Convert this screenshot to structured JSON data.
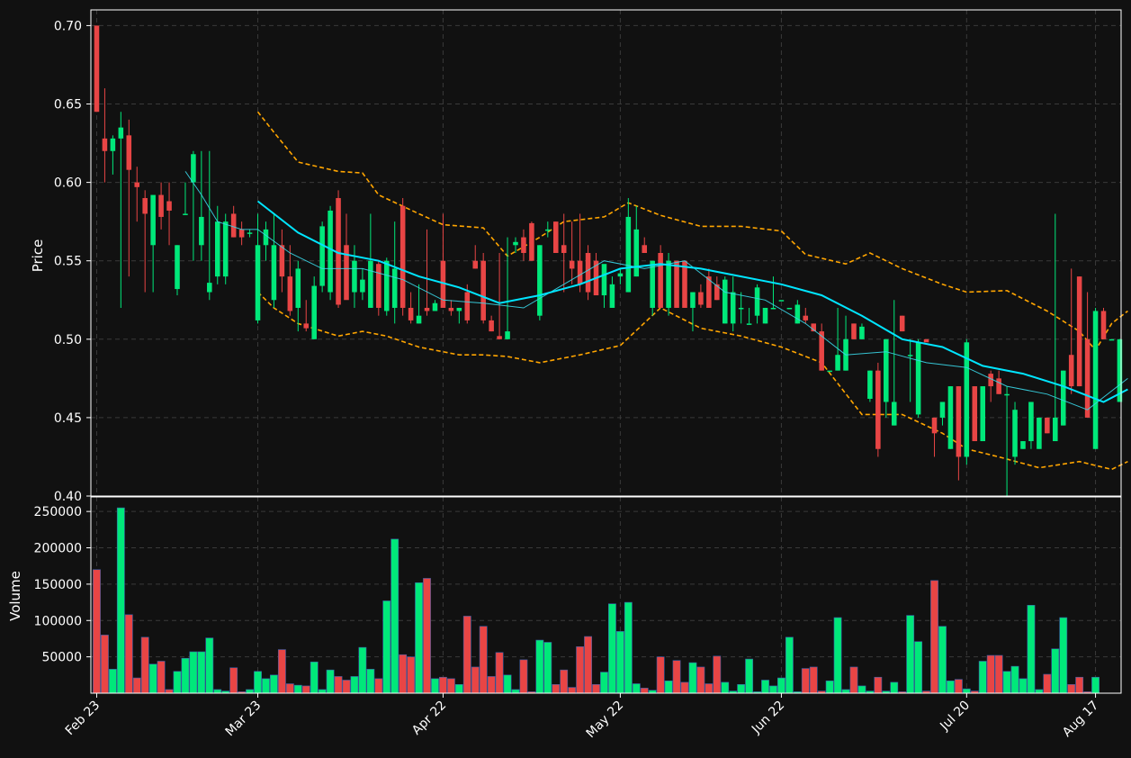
{
  "chart_data": [
    {
      "type": "candlestick",
      "ylabel": "Price",
      "ylim": [
        0.4,
        0.71
      ],
      "yticks": [
        "0.40",
        "0.45",
        "0.50",
        "0.55",
        "0.60",
        "0.65",
        "0.70"
      ],
      "x_tick_labels": [
        "Feb 23",
        "Mar 23",
        "Apr 22",
        "May 22",
        "Jun 22",
        "Jul 20",
        "Aug 17"
      ],
      "x_tick_bar_index": [
        0,
        20,
        43,
        65,
        85,
        108,
        124
      ],
      "grid": true,
      "colors": {
        "up": "#00e87a",
        "down": "#e84545",
        "ma_fast": "#3ad7e8",
        "ma_slow": "#00e5ff",
        "bands": "#ffa500",
        "background": "#111111",
        "grid": "#3a3a3a"
      },
      "series_candles": [
        [
          0.7,
          0.7,
          0.645,
          0.645
        ],
        [
          0.628,
          0.66,
          0.6,
          0.62
        ],
        [
          0.62,
          0.63,
          0.605,
          0.628
        ],
        [
          0.628,
          0.645,
          0.52,
          0.635
        ],
        [
          0.63,
          0.64,
          0.54,
          0.608
        ],
        [
          0.6,
          0.61,
          0.575,
          0.597
        ],
        [
          0.59,
          0.595,
          0.53,
          0.58
        ],
        [
          0.56,
          0.59,
          0.53,
          0.592
        ],
        [
          0.592,
          0.6,
          0.57,
          0.578
        ],
        [
          0.588,
          0.6,
          0.56,
          0.582
        ],
        [
          0.532,
          0.56,
          0.528,
          0.56
        ],
        [
          0.58,
          0.6,
          0.58,
          0.58
        ],
        [
          0.6,
          0.62,
          0.55,
          0.618
        ],
        [
          0.56,
          0.62,
          0.55,
          0.578
        ],
        [
          0.53,
          0.62,
          0.525,
          0.536
        ],
        [
          0.54,
          0.585,
          0.535,
          0.575
        ],
        [
          0.54,
          0.58,
          0.535,
          0.575
        ],
        [
          0.58,
          0.585,
          0.565,
          0.565
        ],
        [
          0.57,
          0.575,
          0.56,
          0.565
        ],
        [
          0.568,
          0.57,
          0.565,
          0.568
        ],
        [
          0.512,
          0.58,
          0.51,
          0.56
        ],
        [
          0.56,
          0.575,
          0.55,
          0.57
        ],
        [
          0.525,
          0.58,
          0.52,
          0.56
        ],
        [
          0.56,
          0.57,
          0.53,
          0.54
        ],
        [
          0.54,
          0.56,
          0.515,
          0.518
        ],
        [
          0.52,
          0.55,
          0.505,
          0.545
        ],
        [
          0.51,
          0.525,
          0.505,
          0.507
        ],
        [
          0.5,
          0.54,
          0.5,
          0.534
        ],
        [
          0.534,
          0.575,
          0.53,
          0.572
        ],
        [
          0.53,
          0.585,
          0.525,
          0.582
        ],
        [
          0.59,
          0.595,
          0.52,
          0.522
        ],
        [
          0.56,
          0.58,
          0.55,
          0.525
        ],
        [
          0.53,
          0.56,
          0.52,
          0.55
        ],
        [
          0.53,
          0.545,
          0.525,
          0.538
        ],
        [
          0.52,
          0.58,
          0.52,
          0.55
        ],
        [
          0.548,
          0.55,
          0.515,
          0.52
        ],
        [
          0.518,
          0.552,
          0.515,
          0.55
        ],
        [
          0.52,
          0.575,
          0.51,
          0.545
        ],
        [
          0.585,
          0.59,
          0.515,
          0.52
        ],
        [
          0.52,
          0.53,
          0.51,
          0.512
        ],
        [
          0.51,
          0.535,
          0.51,
          0.515
        ],
        [
          0.52,
          0.57,
          0.515,
          0.518
        ],
        [
          0.518,
          0.525,
          0.518,
          0.523
        ],
        [
          0.55,
          0.58,
          0.52,
          0.52
        ],
        [
          0.52,
          0.525,
          0.515,
          0.518
        ],
        [
          0.518,
          0.52,
          0.51,
          0.52
        ],
        [
          0.53,
          0.535,
          0.51,
          0.512
        ],
        [
          0.55,
          0.56,
          0.545,
          0.545
        ],
        [
          0.55,
          0.555,
          0.51,
          0.512
        ],
        [
          0.512,
          0.515,
          0.505,
          0.505
        ],
        [
          0.502,
          0.555,
          0.5,
          0.5
        ],
        [
          0.5,
          0.565,
          0.5,
          0.505
        ],
        [
          0.56,
          0.565,
          0.555,
          0.562
        ],
        [
          0.565,
          0.57,
          0.55,
          0.555
        ],
        [
          0.574,
          0.575,
          0.55,
          0.55
        ],
        [
          0.515,
          0.56,
          0.512,
          0.56
        ],
        [
          0.57,
          0.575,
          0.565,
          0.57
        ],
        [
          0.575,
          0.575,
          0.555,
          0.555
        ],
        [
          0.56,
          0.58,
          0.53,
          0.555
        ],
        [
          0.55,
          0.575,
          0.535,
          0.545
        ],
        [
          0.55,
          0.58,
          0.53,
          0.535
        ],
        [
          0.555,
          0.56,
          0.525,
          0.53
        ],
        [
          0.55,
          0.555,
          0.53,
          0.528
        ],
        [
          0.528,
          0.545,
          0.52,
          0.548
        ],
        [
          0.52,
          0.54,
          0.52,
          0.535
        ],
        [
          0.54,
          0.545,
          0.535,
          0.542
        ],
        [
          0.53,
          0.59,
          0.53,
          0.578
        ],
        [
          0.54,
          0.585,
          0.54,
          0.57
        ],
        [
          0.56,
          0.565,
          0.555,
          0.555
        ],
        [
          0.52,
          0.55,
          0.515,
          0.55
        ],
        [
          0.555,
          0.56,
          0.52,
          0.52
        ],
        [
          0.52,
          0.555,
          0.515,
          0.55
        ],
        [
          0.55,
          0.55,
          0.52,
          0.52
        ],
        [
          0.55,
          0.55,
          0.52,
          0.52
        ],
        [
          0.52,
          0.53,
          0.505,
          0.53
        ],
        [
          0.53,
          0.535,
          0.52,
          0.522
        ],
        [
          0.54,
          0.545,
          0.52,
          0.52
        ],
        [
          0.535,
          0.54,
          0.525,
          0.525
        ],
        [
          0.51,
          0.54,
          0.51,
          0.538
        ],
        [
          0.51,
          0.54,
          0.505,
          0.53
        ],
        [
          0.52,
          0.53,
          0.51,
          0.52
        ],
        [
          0.51,
          0.52,
          0.51,
          0.51
        ],
        [
          0.515,
          0.535,
          0.51,
          0.533
        ],
        [
          0.51,
          0.52,
          0.51,
          0.52
        ],
        [
          0.52,
          0.54,
          0.52,
          0.52
        ],
        [
          0.525,
          0.525,
          0.525,
          0.525
        ],
        [
          0.52,
          0.52,
          0.52,
          0.52
        ],
        [
          0.51,
          0.525,
          0.51,
          0.522
        ],
        [
          0.515,
          0.52,
          0.51,
          0.512
        ],
        [
          0.51,
          0.51,
          0.505,
          0.505
        ],
        [
          0.505,
          0.51,
          0.48,
          0.48
        ],
        [
          0.48,
          0.48,
          0.48,
          0.48
        ],
        [
          0.48,
          0.52,
          0.48,
          0.49
        ],
        [
          0.48,
          0.515,
          0.48,
          0.5
        ],
        [
          0.51,
          0.51,
          0.5,
          0.5
        ],
        [
          0.5,
          0.51,
          0.5,
          0.508
        ],
        [
          0.462,
          0.48,
          0.46,
          0.48
        ],
        [
          0.48,
          0.485,
          0.425,
          0.43
        ],
        [
          0.46,
          0.5,
          0.45,
          0.5
        ],
        [
          0.445,
          0.525,
          0.445,
          0.46
        ],
        [
          0.515,
          0.515,
          0.505,
          0.505
        ],
        [
          0.49,
          0.5,
          0.46,
          0.49
        ],
        [
          0.452,
          0.5,
          0.45,
          0.498
        ],
        [
          0.5,
          0.5,
          0.5,
          0.498
        ],
        [
          0.45,
          0.45,
          0.425,
          0.44
        ],
        [
          0.45,
          0.46,
          0.445,
          0.46
        ],
        [
          0.43,
          0.47,
          0.43,
          0.47
        ],
        [
          0.47,
          0.47,
          0.41,
          0.425
        ],
        [
          0.425,
          0.5,
          0.42,
          0.498
        ],
        [
          0.47,
          0.47,
          0.44,
          0.435
        ],
        [
          0.435,
          0.47,
          0.435,
          0.47
        ],
        [
          0.478,
          0.48,
          0.46,
          0.47
        ],
        [
          0.475,
          0.48,
          0.465,
          0.465
        ],
        [
          0.465,
          0.47,
          0.4,
          0.465
        ],
        [
          0.425,
          0.46,
          0.42,
          0.455
        ],
        [
          0.43,
          0.435,
          0.43,
          0.435
        ],
        [
          0.435,
          0.46,
          0.43,
          0.46
        ],
        [
          0.43,
          0.45,
          0.43,
          0.45
        ],
        [
          0.45,
          0.45,
          0.44,
          0.44
        ],
        [
          0.435,
          0.58,
          0.435,
          0.45
        ],
        [
          0.445,
          0.48,
          0.445,
          0.48
        ],
        [
          0.49,
          0.545,
          0.465,
          0.47
        ],
        [
          0.54,
          0.54,
          0.47,
          0.47
        ],
        [
          0.5,
          0.53,
          0.45,
          0.45
        ],
        [
          0.43,
          0.52,
          0.43,
          0.518
        ],
        [
          0.518,
          0.52,
          0.5,
          0.5
        ],
        [
          0.5,
          0.5,
          0.5,
          0.5
        ],
        [
          0.46,
          0.5,
          0.46,
          0.5
        ]
      ],
      "ma_fast": [
        [
          11,
          0.607
        ],
        [
          13,
          0.592
        ],
        [
          15,
          0.575
        ],
        [
          18,
          0.57
        ],
        [
          20,
          0.57
        ],
        [
          24,
          0.555
        ],
        [
          28,
          0.545
        ],
        [
          33,
          0.545
        ],
        [
          38,
          0.538
        ],
        [
          43,
          0.525
        ],
        [
          48,
          0.523
        ],
        [
          53,
          0.52
        ],
        [
          58,
          0.535
        ],
        [
          63,
          0.55
        ],
        [
          68,
          0.545
        ],
        [
          73,
          0.55
        ],
        [
          78,
          0.53
        ],
        [
          83,
          0.525
        ],
        [
          88,
          0.51
        ],
        [
          93,
          0.49
        ],
        [
          98,
          0.492
        ],
        [
          103,
          0.485
        ],
        [
          108,
          0.482
        ],
        [
          113,
          0.47
        ],
        [
          118,
          0.465
        ],
        [
          123,
          0.455
        ],
        [
          128,
          0.475
        ]
      ],
      "ma_slow": [
        [
          20,
          0.588
        ],
        [
          25,
          0.568
        ],
        [
          30,
          0.555
        ],
        [
          35,
          0.55
        ],
        [
          40,
          0.54
        ],
        [
          45,
          0.533
        ],
        [
          50,
          0.523
        ],
        [
          55,
          0.528
        ],
        [
          60,
          0.535
        ],
        [
          65,
          0.545
        ],
        [
          70,
          0.548
        ],
        [
          75,
          0.545
        ],
        [
          80,
          0.54
        ],
        [
          85,
          0.535
        ],
        [
          90,
          0.528
        ],
        [
          95,
          0.515
        ],
        [
          100,
          0.5
        ],
        [
          105,
          0.495
        ],
        [
          110,
          0.483
        ],
        [
          115,
          0.478
        ],
        [
          120,
          0.47
        ],
        [
          125,
          0.46
        ],
        [
          128,
          0.468
        ]
      ],
      "band_upper": [
        [
          20,
          0.645
        ],
        [
          22,
          0.632
        ],
        [
          25,
          0.613
        ],
        [
          30,
          0.607
        ],
        [
          33,
          0.606
        ],
        [
          35,
          0.592
        ],
        [
          40,
          0.58
        ],
        [
          43,
          0.573
        ],
        [
          48,
          0.571
        ],
        [
          51,
          0.553
        ],
        [
          55,
          0.565
        ],
        [
          58,
          0.575
        ],
        [
          63,
          0.578
        ],
        [
          66,
          0.587
        ],
        [
          70,
          0.579
        ],
        [
          75,
          0.572
        ],
        [
          80,
          0.572
        ],
        [
          85,
          0.569
        ],
        [
          88,
          0.554
        ],
        [
          93,
          0.548
        ],
        [
          96,
          0.555
        ],
        [
          100,
          0.545
        ],
        [
          105,
          0.535
        ],
        [
          108,
          0.53
        ],
        [
          113,
          0.531
        ],
        [
          118,
          0.518
        ],
        [
          122,
          0.505
        ],
        [
          124,
          0.493
        ],
        [
          126,
          0.51
        ],
        [
          128,
          0.518
        ]
      ],
      "band_lower": [
        [
          20,
          0.53
        ],
        [
          22,
          0.52
        ],
        [
          25,
          0.51
        ],
        [
          30,
          0.502
        ],
        [
          33,
          0.505
        ],
        [
          36,
          0.502
        ],
        [
          40,
          0.495
        ],
        [
          45,
          0.49
        ],
        [
          48,
          0.49
        ],
        [
          51,
          0.489
        ],
        [
          55,
          0.485
        ],
        [
          60,
          0.49
        ],
        [
          65,
          0.496
        ],
        [
          70,
          0.52
        ],
        [
          75,
          0.507
        ],
        [
          80,
          0.502
        ],
        [
          85,
          0.495
        ],
        [
          90,
          0.485
        ],
        [
          95,
          0.452
        ],
        [
          100,
          0.452
        ],
        [
          105,
          0.44
        ],
        [
          108,
          0.43
        ],
        [
          112,
          0.425
        ],
        [
          117,
          0.418
        ],
        [
          122,
          0.422
        ],
        [
          126,
          0.417
        ],
        [
          128,
          0.422
        ]
      ]
    },
    {
      "type": "bar",
      "ylabel": "Volume",
      "ylim": [
        0,
        270000
      ],
      "yticks": [
        "50000",
        "100000",
        "150000",
        "200000",
        "250000"
      ],
      "values": [
        170000,
        80000,
        33000,
        255000,
        108000,
        21000,
        77000,
        40000,
        44000,
        5000,
        30000,
        48000,
        57000,
        57000,
        76000,
        5000,
        3000,
        35000,
        2000,
        5000,
        30000,
        20000,
        25000,
        60000,
        13000,
        11000,
        10000,
        43000,
        5000,
        32000,
        23000,
        18000,
        23000,
        63000,
        33000,
        20000,
        127000,
        212000,
        53000,
        50000,
        152000,
        158000,
        20000,
        22000,
        20000,
        12000,
        106000,
        36000,
        92000,
        23000,
        56000,
        25000,
        5000,
        46000,
        2000,
        73000,
        70000,
        12000,
        32000,
        8000,
        64000,
        78000,
        12000,
        29000,
        123000,
        85000,
        125000,
        13000,
        7000,
        4000,
        50000,
        17000,
        45000,
        15000,
        42000,
        36000,
        13000,
        51000,
        15000,
        3000,
        12000,
        47000,
        2000,
        18000,
        10000,
        21000,
        77000,
        2000,
        34000,
        36000,
        3000,
        17000,
        104000,
        5000,
        36000,
        10000,
        3000,
        22000,
        3000,
        15000,
        2000,
        107000,
        71000,
        3000,
        155000,
        92000,
        17000,
        19000,
        6000,
        3000,
        44000,
        52000,
        52000,
        30000,
        37000,
        20000,
        121000,
        5000,
        26000,
        61000,
        104000,
        12000,
        22000,
        2000,
        22000
      ]
    }
  ]
}
